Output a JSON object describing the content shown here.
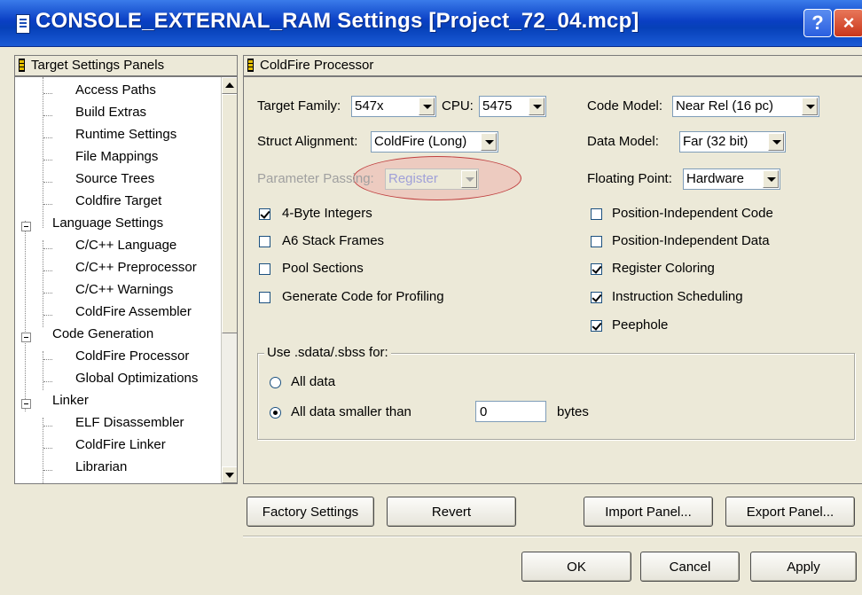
{
  "window": {
    "title": "CONSOLE_EXTERNAL_RAM Settings [Project_72_04.mcp]",
    "help_label": "?",
    "close_label": "×"
  },
  "tree": {
    "header": "Target Settings Panels",
    "items": [
      {
        "label": "Access Paths",
        "level": 1
      },
      {
        "label": "Build Extras",
        "level": 1
      },
      {
        "label": "Runtime Settings",
        "level": 1
      },
      {
        "label": "File Mappings",
        "level": 1
      },
      {
        "label": "Source Trees",
        "level": 1
      },
      {
        "label": "Coldfire Target",
        "level": 1
      },
      {
        "label": "Language Settings",
        "level": 0
      },
      {
        "label": "C/C++ Language",
        "level": 1
      },
      {
        "label": "C/C++ Preprocessor",
        "level": 1
      },
      {
        "label": "C/C++ Warnings",
        "level": 1
      },
      {
        "label": "ColdFire Assembler",
        "level": 1
      },
      {
        "label": "Code Generation",
        "level": 0
      },
      {
        "label": "ColdFire Processor",
        "level": 1
      },
      {
        "label": "Global Optimizations",
        "level": 1
      },
      {
        "label": "Linker",
        "level": 0
      },
      {
        "label": "ELF Disassembler",
        "level": 1
      },
      {
        "label": "ColdFire Linker",
        "level": 1
      },
      {
        "label": "Librarian",
        "level": 1
      }
    ]
  },
  "panel": {
    "header": "ColdFire Processor",
    "target_family_label": "Target Family:",
    "target_family_value": "547x",
    "cpu_label": "CPU:",
    "cpu_value": "5475",
    "struct_alignment_label": "Struct Alignment:",
    "struct_alignment_value": "ColdFire (Long)",
    "parameter_passing_label": "Parameter Passing:",
    "parameter_passing_value": "Register",
    "code_model_label": "Code Model:",
    "code_model_value": "Near Rel (16  pc)",
    "data_model_label": "Data Model:",
    "data_model_value": "Far (32 bit)",
    "floating_point_label": "Floating Point:",
    "floating_point_value": "Hardware",
    "left_checkboxes": [
      {
        "label": "4-Byte Integers",
        "checked": true
      },
      {
        "label": "A6 Stack Frames",
        "checked": false
      },
      {
        "label": "Pool Sections",
        "checked": false
      },
      {
        "label": "Generate Code for Profiling",
        "checked": false
      }
    ],
    "right_checkboxes": [
      {
        "label": "Position-Independent Code",
        "checked": false
      },
      {
        "label": "Position-Independent Data",
        "checked": false
      },
      {
        "label": "Register Coloring",
        "checked": true
      },
      {
        "label": "Instruction Scheduling",
        "checked": true
      },
      {
        "label": "Peephole",
        "checked": true
      }
    ],
    "sdata_group": {
      "title": "Use .sdata/.sbss for:",
      "all_data_label": "All data",
      "smaller_than_label": "All data smaller than",
      "size_value": "0",
      "bytes_label": "bytes",
      "selected": "smaller_than"
    }
  },
  "buttons": {
    "factory_settings": "Factory Settings",
    "revert": "Revert",
    "import_panel": "Import Panel...",
    "export_panel": "Export Panel...",
    "ok": "OK",
    "cancel": "Cancel",
    "apply": "Apply"
  }
}
